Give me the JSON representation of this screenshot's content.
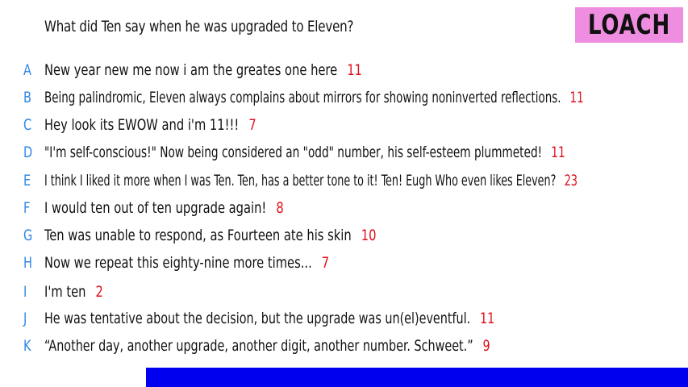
{
  "question": "What did Ten say when he was upgraded to Eleven?",
  "logo": "LOACH",
  "colors": {
    "letter": "#2f86e6",
    "score": "#e0101c",
    "logo_bg": "#ef8de0",
    "bar": "#0000ee"
  },
  "responses": [
    {
      "letter": "A",
      "text": "New year new me now i am the greates one here",
      "score": "11"
    },
    {
      "letter": "B",
      "text": "Being palindromic, Eleven always complains about mirrors for showing noninverted reflections.",
      "score": "11"
    },
    {
      "letter": "C",
      "text": "Hey look its EWOW and i'm 11!!!",
      "score": "7"
    },
    {
      "letter": "D",
      "text": "\"I'm self-conscious!\" Now being considered an \"odd\" number, his self-esteem plummeted!",
      "score": "11"
    },
    {
      "letter": "E",
      "text": "I think I liked it more when I was Ten. Ten, has a better tone to it! Ten! Eugh Who even likes Eleven?",
      "score": "23"
    },
    {
      "letter": "F",
      "text": "I would ten out of ten upgrade again!",
      "score": "8"
    },
    {
      "letter": "G",
      "text": "Ten was unable to respond, as Fourteen ate his skin",
      "score": "10"
    },
    {
      "letter": "H",
      "text": "Now we repeat this eighty-nine more times...",
      "score": "7"
    },
    {
      "letter": "I",
      "text": "I'm ten",
      "score": "2"
    },
    {
      "letter": "J",
      "text": "He was tentative about the decision, but the upgrade was un(el)eventful.",
      "score": "11"
    },
    {
      "letter": "K",
      "text": "“Another day, another upgrade, another digit, another number. Schweet.”",
      "score": "9"
    }
  ]
}
